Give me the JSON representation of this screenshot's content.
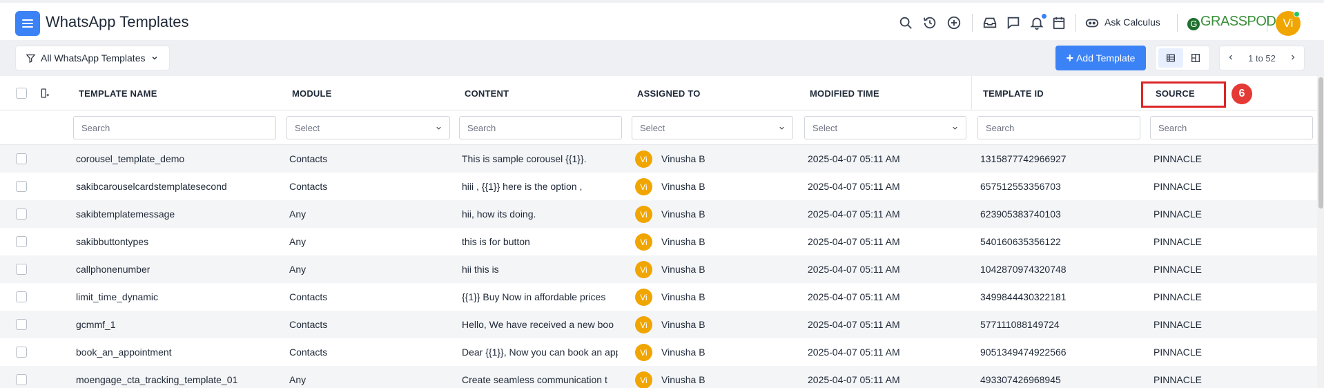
{
  "header": {
    "title": "WhatsApp Templates",
    "ask_label": "Ask Calculus",
    "logo_text": "GRASSPODS",
    "avatar": "Vi",
    "icons": [
      "search-icon",
      "history-icon",
      "add-circle-icon",
      "inbox-icon",
      "chat-icon",
      "bell-icon",
      "calendar-icon",
      "bot-icon"
    ]
  },
  "toolbar": {
    "filter_label": "All WhatsApp Templates",
    "add_label": "Add Template",
    "pager_range": "1 to 52",
    "accent": "#3b82f6"
  },
  "table": {
    "columns": [
      "TEMPLATE NAME",
      "MODULE",
      "CONTENT",
      "ASSIGNED TO",
      "MODIFIED TIME",
      "TEMPLATE ID",
      "SOURCE"
    ],
    "filters": {
      "name": "Search",
      "module": "Select",
      "content": "Search",
      "assigned": "Select",
      "modified": "Select",
      "template_id": "Search",
      "source": "Search"
    },
    "annotation_badge": "6",
    "rows": [
      {
        "name": "corousel_template_demo",
        "module": "Contacts",
        "content": "This is sample corousel {{1}}.",
        "initials": "Vi",
        "assigned": "Vinusha B",
        "modified": "2025-04-07 05:11 AM",
        "id": "1315877742966927",
        "source": "PINNACLE"
      },
      {
        "name": "sakibcarouselcardstemplatesecond",
        "module": "Contacts",
        "content": "hiii , {{1}} here is the option ,",
        "initials": "Vi",
        "assigned": "Vinusha B",
        "modified": "2025-04-07 05:11 AM",
        "id": "657512553356703",
        "source": "PINNACLE"
      },
      {
        "name": "sakibtemplatemessage",
        "module": "Any",
        "content": "hii, how its doing.",
        "initials": "Vi",
        "assigned": "Vinusha B",
        "modified": "2025-04-07 05:11 AM",
        "id": "623905383740103",
        "source": "PINNACLE"
      },
      {
        "name": "sakibbuttontypes",
        "module": "Any",
        "content": "this is for button",
        "initials": "Vi",
        "assigned": "Vinusha B",
        "modified": "2025-04-07 05:11 AM",
        "id": "540160635356122",
        "source": "PINNACLE"
      },
      {
        "name": "callphonenumber",
        "module": "Any",
        "content": "hii this is",
        "initials": "Vi",
        "assigned": "Vinusha B",
        "modified": "2025-04-07 05:11 AM",
        "id": "1042870974320748",
        "source": "PINNACLE"
      },
      {
        "name": "limit_time_dynamic",
        "module": "Contacts",
        "content": "{{1}} Buy Now in affordable prices",
        "initials": "Vi",
        "assigned": "Vinusha B",
        "modified": "2025-04-07 05:11 AM",
        "id": "3499844430322181",
        "source": "PINNACLE"
      },
      {
        "name": "gcmmf_1",
        "module": "Contacts",
        "content": "Hello, We have received a new boo",
        "initials": "Vi",
        "assigned": "Vinusha B",
        "modified": "2025-04-07 05:11 AM",
        "id": "577111088149724",
        "source": "PINNACLE"
      },
      {
        "name": "book_an_appointment",
        "module": "Contacts",
        "content": "Dear {{1}}, Now you can book an app",
        "initials": "Vi",
        "assigned": "Vinusha B",
        "modified": "2025-04-07 05:11 AM",
        "id": "9051349474922566",
        "source": "PINNACLE"
      },
      {
        "name": "moengage_cta_tracking_template_01",
        "module": "Any",
        "content": "Create seamless communication t",
        "initials": "Vi",
        "assigned": "Vinusha B",
        "modified": "2025-04-07 05:11 AM",
        "id": "493307426968945",
        "source": "PINNACLE"
      }
    ]
  }
}
